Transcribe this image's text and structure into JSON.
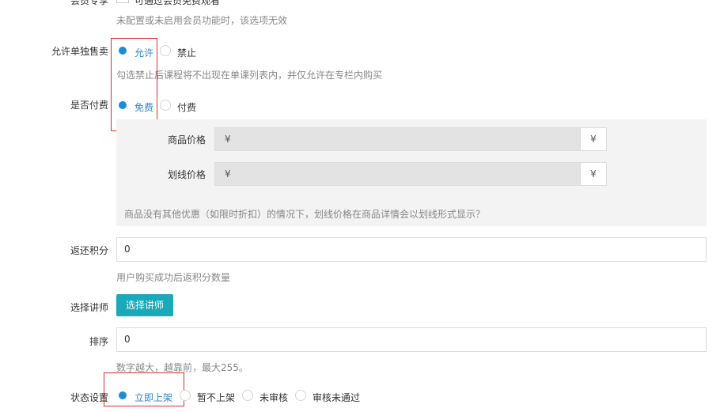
{
  "member_discount": {
    "label": "会员专享",
    "checkbox_text": "可通过会员免费观看",
    "hint": "未配置或未启用会员功能时，该选项无效"
  },
  "allow_single_sale": {
    "label": "允许单独售卖",
    "options": [
      "允许",
      "禁止"
    ],
    "selected": "允许",
    "hint": "勾选禁止后课程将不出现在单课列表内，并仅允许在专栏内购买"
  },
  "is_paid": {
    "label": "是否付费",
    "options": [
      "免费",
      "付费"
    ],
    "selected": "免费"
  },
  "pricing": {
    "product_price_label": "商品价格",
    "product_price_prefix": "¥",
    "product_price_suffix": "¥",
    "strike_price_label": "划线价格",
    "strike_price_prefix": "¥",
    "strike_price_suffix": "¥",
    "hint": "商品没有其他优惠（如限时折扣）的情况下，划线价格在商品详情会以划线形式显示？"
  },
  "points": {
    "label": "返还积分",
    "value": "0",
    "hint": "用户购买成功后返积分数量"
  },
  "lecturer": {
    "label": "选择讲师",
    "button": "选择讲师"
  },
  "sort": {
    "label": "排序",
    "value": "0",
    "hint": "数字越大，越靠前，最大255。"
  },
  "status": {
    "label": "状态设置",
    "options": [
      "立即上架",
      "暂不上架",
      "未审核",
      "审核未通过"
    ],
    "selected": "立即上架"
  },
  "colors": {
    "accent_radio": "#1a8cd8",
    "button": "#1aa9b8",
    "highlight_box": "#d9302c"
  }
}
